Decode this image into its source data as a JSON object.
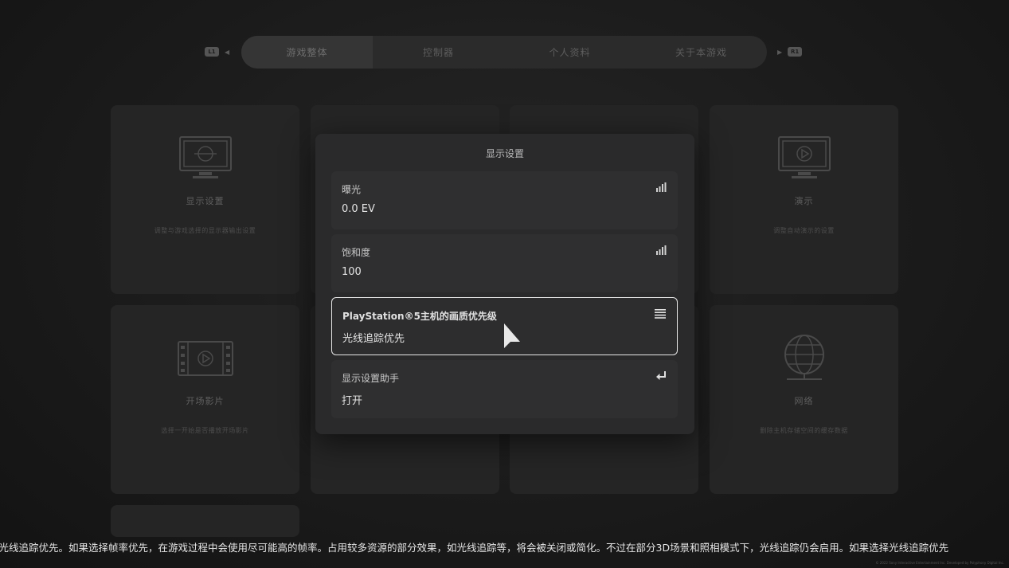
{
  "tabs": [
    {
      "label": "游戏整体",
      "active": true
    },
    {
      "label": "控制器",
      "active": false
    },
    {
      "label": "个人资料",
      "active": false
    },
    {
      "label": "关于本游戏",
      "active": false
    }
  ],
  "shoulder": {
    "left": "L1",
    "right": "R1"
  },
  "cards": [
    {
      "title": "显示设置",
      "desc": "调整与游戏选择的显示器输出设置",
      "icon": "monitor-icon"
    },
    {
      "title": "演示",
      "desc": "调整自动演示的设置",
      "icon": "monitor-play-icon"
    },
    {
      "title": "开场影片",
      "desc": "选择一开始是否播放开场影片",
      "icon": "film-icon"
    },
    {
      "title": "网络",
      "desc": "删除主机存储空间的缓存数据",
      "icon": "globe-icon"
    }
  ],
  "modal": {
    "title": "显示设置",
    "rows": [
      {
        "label": "曝光",
        "value": "0.0 EV",
        "icon": "slider-bars-icon"
      },
      {
        "label": "饱和度",
        "value": "100",
        "icon": "slider-bars-icon"
      },
      {
        "label": "PlayStation®5主机的画质优先级",
        "value": "光线追踪优先",
        "icon": "list-icon",
        "selected": true
      },
      {
        "label": "显示设置助手",
        "value": "打开",
        "icon": "enter-icon"
      }
    ]
  },
  "ticker": "是光线追踪优先。如果选择帧率优先，在游戏过程中会使用尽可能高的帧率。占用较多资源的部分效果，如光线追踪等，将会被关闭或简化。不过在部分3D场景和照相模式下，光线追踪仍会启用。如果选择光线追踪优先",
  "copyright": "© 2022 Sony Interactive Entertainment Inc. Developed by Polyphony Digital Inc."
}
